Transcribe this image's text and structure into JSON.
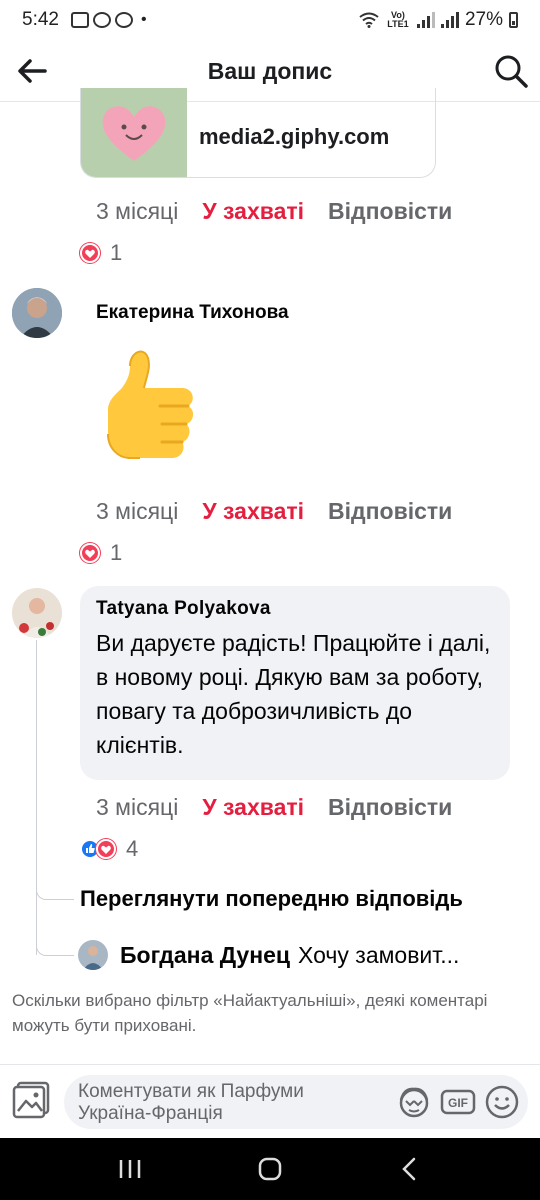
{
  "status_bar": {
    "time": "5:42",
    "dot": "•",
    "battery": "27%",
    "network_label": "Vo) LTE1"
  },
  "header": {
    "title": "Ваш допис",
    "back_icon": "arrow-left-icon",
    "search_icon": "search-icon"
  },
  "link_card": {
    "domain": "media2.giphy.com"
  },
  "comments": [
    {
      "time": "3 місяці",
      "like_label": "У захваті",
      "reply_label": "Відповісти",
      "reaction_count": "1"
    },
    {
      "author": "Екатерина Тихонова",
      "sticker": "thumbs-up-sticker",
      "time": "3 місяці",
      "like_label": "У захваті",
      "reply_label": "Відповісти",
      "reaction_count": "1"
    },
    {
      "author": "Tatyana  Polyakova",
      "text": "Ви даруєте радість! Працюйте і далі, в новому році. Дякую вам за роботу, повагу та доброзичливість до клієнтів.",
      "time": "3 місяці",
      "like_label": "У захваті",
      "reply_label": "Відповісти",
      "reaction_count": "4"
    }
  ],
  "thread": {
    "view_previous": "Переглянути попередню відповідь",
    "reply_author": "Богдана Дунец",
    "reply_preview": "Хочу замовит..."
  },
  "filter_note": "Оскільки вибрано фільтр «Найактуальніші», деякі коментарі можуть бути приховані.",
  "composer": {
    "placeholder": "Коментувати як Парфуми Україна-Франція",
    "gif_label": "GIF"
  },
  "colors": {
    "like_red": "#e41e3f",
    "meta_gray": "#65676b",
    "bubble_bg": "#f0f2f5",
    "fb_blue": "#1877f2"
  }
}
